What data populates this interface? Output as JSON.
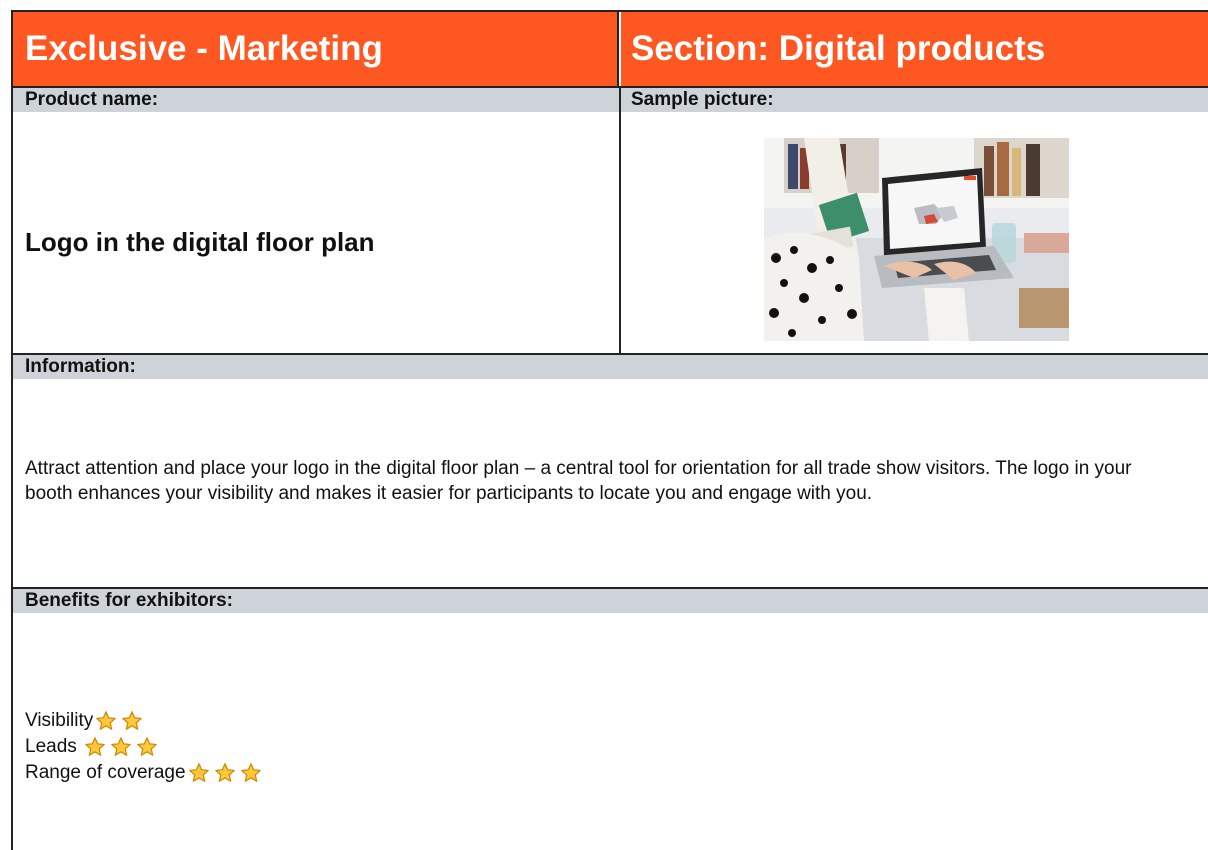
{
  "header": {
    "left_title": "Exclusive - Marketing",
    "right_title": "Section: Digital products"
  },
  "product": {
    "label": "Product name:",
    "name": "Logo in the digital floor plan"
  },
  "sample": {
    "label": "Sample picture:"
  },
  "information": {
    "label": "Information:",
    "text": "Attract attention and place your logo in the digital floor plan – a central tool for orientation for all trade show visitors. The logo in your booth enhances your visibility and makes it easier for participants to locate you and engage with you."
  },
  "benefits": {
    "label": "Benefits for exhibitors:",
    "items": [
      {
        "label": "Visibility",
        "stars": 2
      },
      {
        "label": "Leads ",
        "stars": 3
      },
      {
        "label": "Range of coverage",
        "stars": 3
      }
    ]
  },
  "colors": {
    "header_bg": "#FF5722",
    "band_bg": "#cdd3d9",
    "star_fill": "#FFC83D",
    "star_stroke": "#D08A00"
  }
}
